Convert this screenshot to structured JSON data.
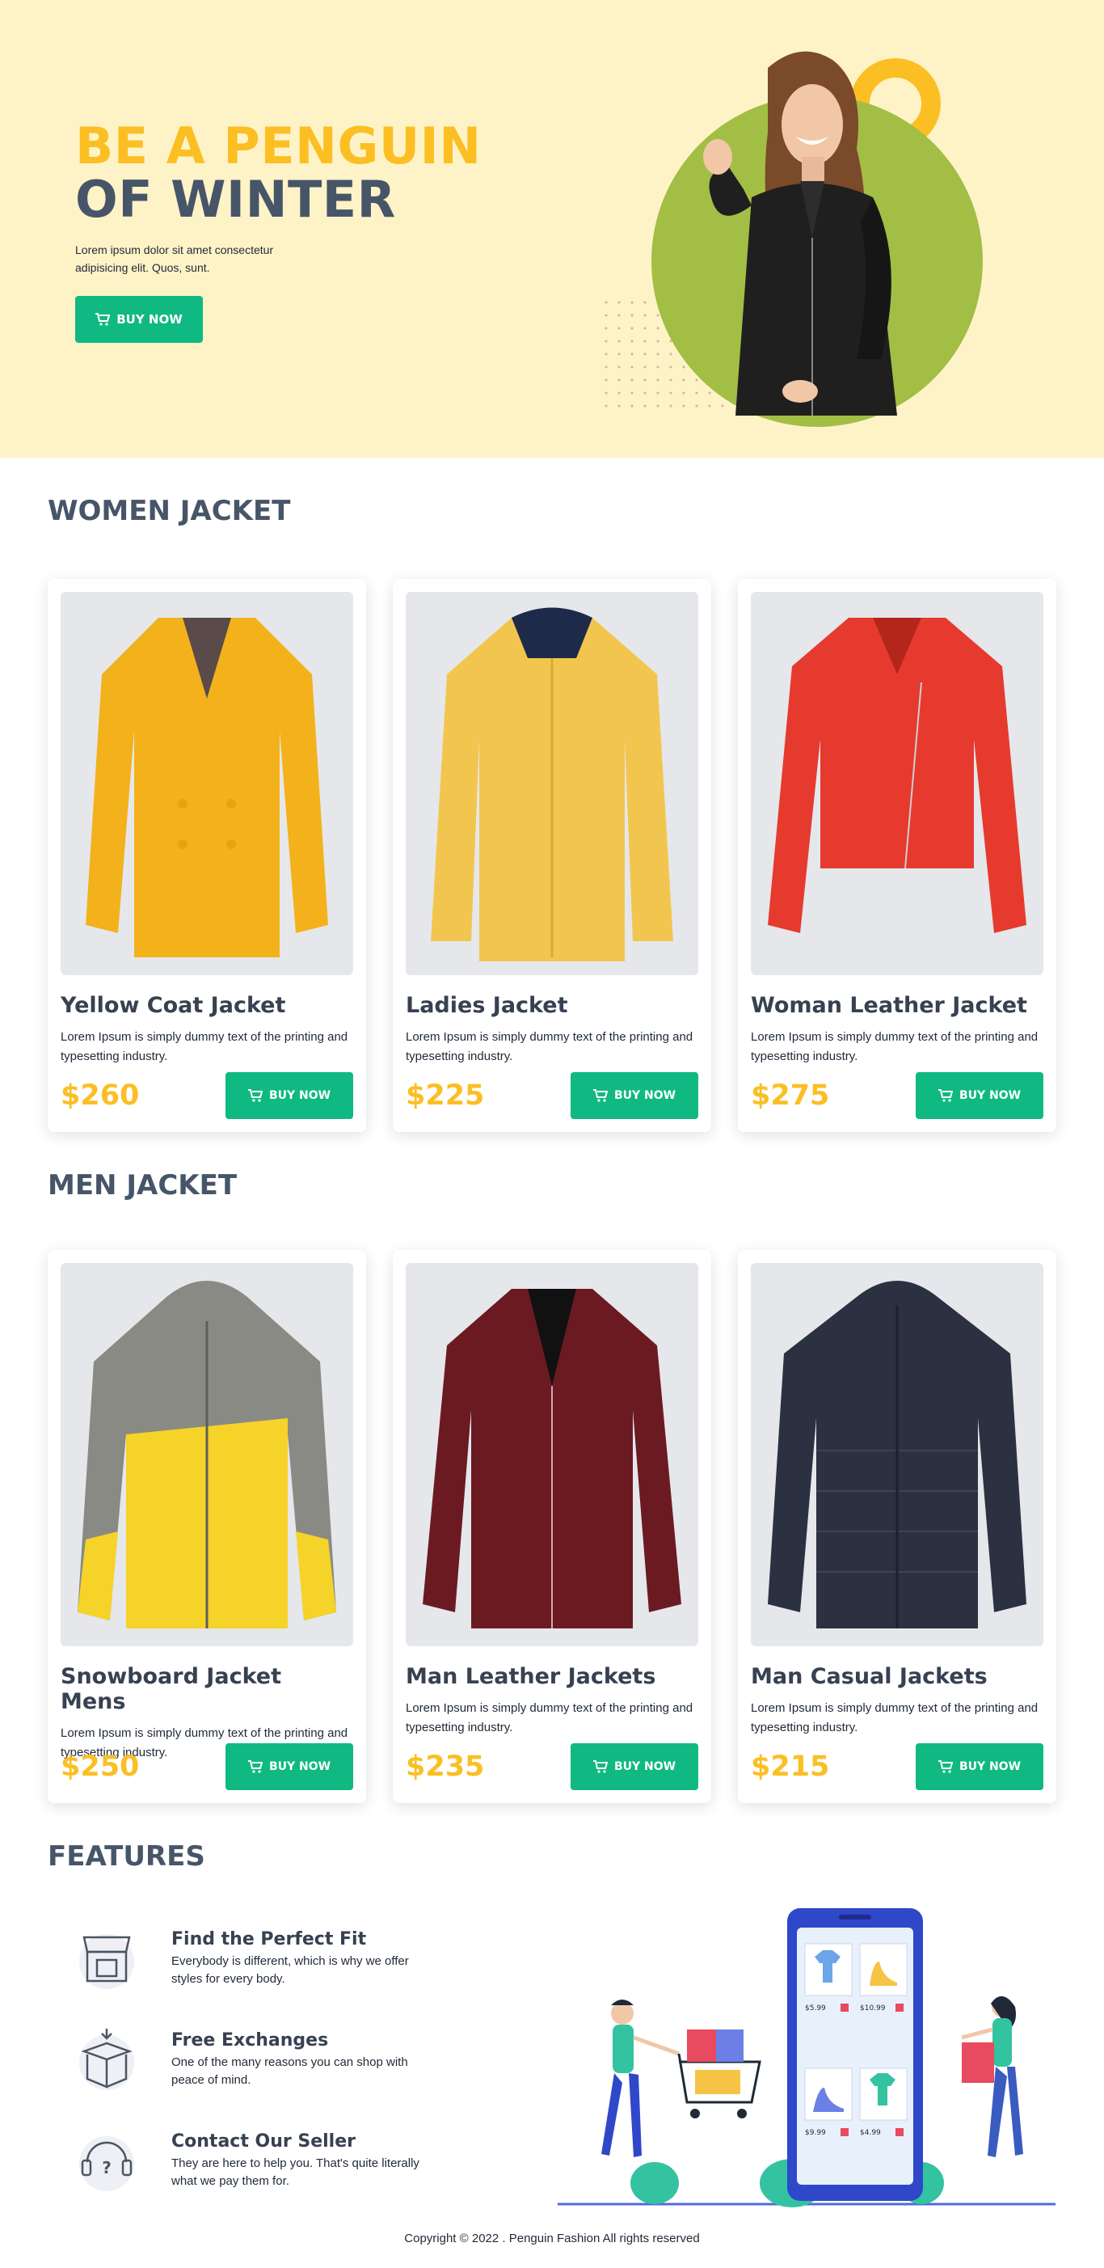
{
  "hero": {
    "title_line1": "BE A PENGUIN",
    "title_line2": "OF WINTER",
    "description": "Lorem ipsum dolor sit amet consectetur adipisicing elit. Quos, sunt.",
    "button_label": "BUY NOW"
  },
  "women": {
    "title": "WOMEN JACKET",
    "items": [
      {
        "name": "Yellow Coat Jacket",
        "desc": "Lorem Ipsum is simply dummy text of the printing and typesetting industry.",
        "price": "$260",
        "button": "BUY NOW",
        "color": "#f3b21c",
        "style": "coat"
      },
      {
        "name": "Ladies Jacket",
        "desc": "Lorem Ipsum is simply dummy text of the printing and typesetting industry.",
        "price": "$225",
        "button": "BUY NOW",
        "color": "#f2c64e",
        "style": "hooded"
      },
      {
        "name": "Woman Leather Jacket",
        "desc": "Lorem Ipsum is simply dummy text of the printing and typesetting industry.",
        "price": "$275",
        "button": "BUY NOW",
        "color": "#e63a2e",
        "style": "leather"
      }
    ]
  },
  "men": {
    "title": "MEN JACKET",
    "items": [
      {
        "name": "Snowboard Jacket Mens",
        "desc": "Lorem Ipsum is simply dummy text of the printing and typesetting industry.",
        "price": "$250",
        "button": "BUY NOW",
        "color": "#f5d328",
        "style": "snowboard"
      },
      {
        "name": "Man Leather Jackets",
        "desc": "Lorem Ipsum is simply dummy text of the printing and typesetting industry.",
        "price": "$235",
        "button": "BUY NOW",
        "color": "#6b1a22",
        "style": "leather-man"
      },
      {
        "name": "Man Casual Jackets",
        "desc": "Lorem Ipsum is simply dummy text of the printing and typesetting industry.",
        "price": "$215",
        "button": "BUY NOW",
        "color": "#2b3140",
        "style": "puffer"
      }
    ]
  },
  "features": {
    "title": "FEATURES",
    "items": [
      {
        "title": "Find the Perfect Fit",
        "desc": "Everybody is different, which is why we offer styles for every body.",
        "icon": "store-icon"
      },
      {
        "title": "Free Exchanges",
        "desc": "One of the many reasons you can shop with peace of mind.",
        "icon": "box-icon"
      },
      {
        "title": "Contact Our Seller",
        "desc": "They are here to help you. That's quite literally what we pay them for.",
        "icon": "support-icon"
      }
    ],
    "illustration_prices": [
      "$5.99",
      "$10.99",
      "$9.99",
      "$4.99"
    ]
  },
  "footer": {
    "copyright": "Copyright © 2022 . Penguin Fashion All rights reserved"
  },
  "colors": {
    "accent": "#10b981",
    "highlight": "#fbbf24",
    "hero_bg": "#fef3c7",
    "heading": "#475569"
  }
}
